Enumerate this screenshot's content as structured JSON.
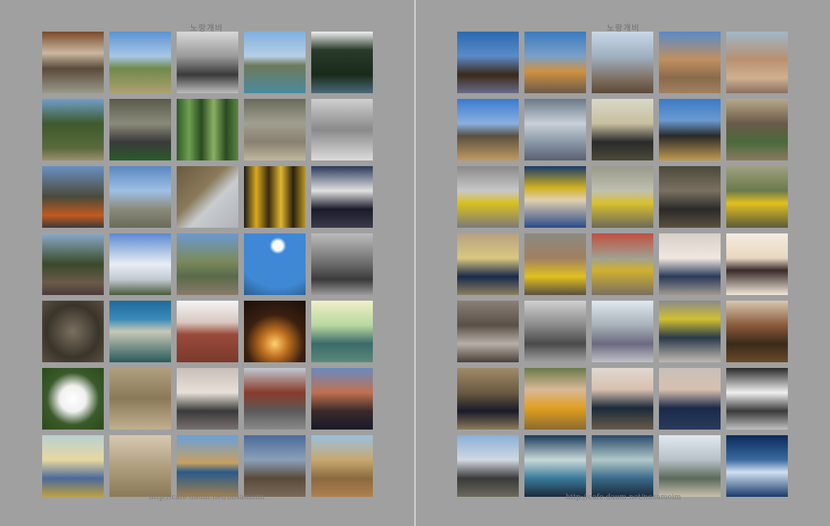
{
  "left_page": {
    "header": "노랑개비",
    "footer": "http://cafe.daum.net/nosamoim",
    "photos": [
      {
        "scene": "group-outdoor",
        "bg": "linear-gradient(#7a4a2a 0%,#c9b8a0 35%,#5a4a3a 60%,#9a9a8a 100%)"
      },
      {
        "scene": "hills-sky",
        "bg": "linear-gradient(#5b93d2 0%,#a9c6e4 40%,#6f8a4a 60%,#b0a070 100%)"
      },
      {
        "scene": "bw-people",
        "bg": "linear-gradient(#d8d8d8 0%,#9a9a9a 40%,#3a3a3a 70%,#bdbdbd 100%)"
      },
      {
        "scene": "pond-village",
        "bg": "linear-gradient(#7fb0e0 0%,#b7cfe5 40%,#6d7a5a 55%,#4a8aa0 100%)"
      },
      {
        "scene": "pine-tree",
        "bg": "linear-gradient(#f0f0f0 0%,#2a3a2a 30%,#1a2a1a 70%,#4a6a7a 100%)"
      },
      {
        "scene": "forest-statue",
        "bg": "linear-gradient(#6f9ec8 0%,#3e5a2e 40%,#5a6a3a 80%,#9a9070 100%)"
      },
      {
        "scene": "people-road",
        "bg": "linear-gradient(#5a5a4a 0%,#8a8a7a 40%,#3a3a3a 70%,#2a5a2a 100%)"
      },
      {
        "scene": "bamboo",
        "bg": "linear-gradient(90deg,#2e5a2a 0%,#6fa050 20%,#2a4a22 40%,#8ab060 60%,#2a4a22 80%,#5a8a40 100%)"
      },
      {
        "scene": "aerial-fields",
        "bg": "linear-gradient(#6a6a5a 0%,#a0a090 40%,#8a8070 70%,#c0b8a0 100%)"
      },
      {
        "scene": "aerial-bw",
        "bg": "linear-gradient(#cfcfcf 0%,#8a8a8a 50%,#dcdcdc 100%)"
      },
      {
        "scene": "woman-trees",
        "bg": "linear-gradient(#6a90c0 0%,#4a4a3a 50%,#c05a20 80%,#3a3a3a 100%)"
      },
      {
        "scene": "mountain-vista",
        "bg": "linear-gradient(#5a86c0 0%,#9ec0e4 40%,#8a8a7a 70%,#6a6a5a 100%)"
      },
      {
        "scene": "rock-sky",
        "bg": "linear-gradient(135deg,#6a5a40 0%,#8a7a5a 40%,#c8ccd0 60%,#b0b4b8 100%)"
      },
      {
        "scene": "yellow-curtain",
        "bg": "linear-gradient(90deg,#1a1a1a 0%,#d8a820 20%,#3a2a10 40%,#e0b830 60%,#2a2010 80%,#c09a20 100%)"
      },
      {
        "scene": "dark-trees",
        "bg": "linear-gradient(#2a3a5a 0%,#e0e0e0 40%,#1a1a2a 70%,#3a3a4a 100%)"
      },
      {
        "scene": "people-bushes",
        "bg": "linear-gradient(#8aaac8 0%,#3a4a2a 50%,#6a5a4a 80%,#4a3a3a 100%)"
      },
      {
        "scene": "white-blossom",
        "bg": "linear-gradient(#5a8ad0 0%,#e8eef4 50%,#c0c8d0 75%,#4a5a3a 100%)"
      },
      {
        "scene": "rocky-peak",
        "bg": "linear-gradient(#6a9ad0 0%,#7a8a5a 45%,#5a6a4a 70%,#8a7a6a 100%)"
      },
      {
        "scene": "cloud-blue",
        "bg": "radial-gradient(circle at 55% 20%,#ffffff 0%,#ffffff 8%,#3d88d8 14%,#3f88d4 70%,#2a5a8a 100%)"
      },
      {
        "scene": "group-bw",
        "bg": "linear-gradient(#bcbcbc 0%,#6a6a6a 50%,#3a3a3a 75%,#9a9a9a 100%)"
      },
      {
        "scene": "pebbles",
        "bg": "radial-gradient(circle,#7a7060 0%,#3a342a 60%,#5a5040 100%)"
      },
      {
        "scene": "pavilion",
        "bg": "linear-gradient(#1f6a9a 0%,#3a8ab8 30%,#c8c8b8 50%,#2a5a5a 100%)"
      },
      {
        "scene": "buddha-carving",
        "bg": "linear-gradient(#f4f4f4 0%,#d8c8c0 35%,#9a4a3a 55%,#7a3a2a 100%)"
      },
      {
        "scene": "candles",
        "bg": "radial-gradient(circle at 50% 70%,#ffd070 0%,#c07020 25%,#3a2010 55%,#1a0e08 100%)"
      },
      {
        "scene": "teal-landscape",
        "bg": "linear-gradient(#f0f0c8 0%,#b8d8a0 40%,#3a6a6a 70%,#5a8a7a 100%)"
      },
      {
        "scene": "chrysanthemum",
        "bg": "radial-gradient(circle,#ffffff 0%,#f0f0f0 30%,#3a5a2a 60%,#2a4a1a 100%)"
      },
      {
        "scene": "dry-grass",
        "bg": "linear-gradient(#b0a080 0%,#8a7a5a 50%,#c0b090 100%)"
      },
      {
        "scene": "meeting-room",
        "bg": "linear-gradient(#c8c0b8 0%,#e8e0d8 40%,#3a3a3a 70%,#7a7070 100%)"
      },
      {
        "scene": "truck-people",
        "bg": "linear-gradient(#c0c8d0 0%,#8a3a2a 40%,#5a5a5a 70%,#8a8a8a 100%)"
      },
      {
        "scene": "three-people",
        "bg": "linear-gradient(#6a8ac0 0%,#c07050 40%,#3a2a2a 70%,#1a1a2a 100%)"
      },
      {
        "scene": "tinted-walk",
        "bg": "linear-gradient(#b8d0d0 0%,#e8d8a0 40%,#4a6a9a 70%,#c0a040 100%)"
      },
      {
        "scene": "hill-path",
        "bg": "linear-gradient(#d8c8b0 0%,#b0a080 50%,#8a7a5a 100%)"
      },
      {
        "scene": "river-reeds",
        "bg": "linear-gradient(#6aa0d8 0%,#c8a060 45%,#2a5a8a 60%,#a08050 100%)"
      },
      {
        "scene": "reeds-water",
        "bg": "linear-gradient(#4a6a9a 0%,#8aa0b8 40%,#5a4a3a 70%,#7a6a5a 100%)"
      },
      {
        "scene": "boardwalk",
        "bg": "linear-gradient(#9ac0e0 0%,#c8a870 40%,#8a6a40 70%,#b08050 100%)"
      }
    ]
  },
  "right_page": {
    "header": "노랑개비",
    "footer": "http://cafe.daum.net/nosamoim",
    "photos": [
      {
        "scene": "couple-lake",
        "bg": "linear-gradient(#2a6ab0 0%,#5a8ac8 40%,#3a2a1a 70%,#6a6a8a 100%)"
      },
      {
        "scene": "group-railing",
        "bg": "linear-gradient(#3a7ac0 0%,#7aa0c8 40%,#d09040 65%,#6a5a4a 100%)"
      },
      {
        "scene": "bare-tree",
        "bg": "linear-gradient(#c8d8e8 0%,#a0b0c0 40%,#7a6a5a 80%,#5a4a3a 100%)"
      },
      {
        "scene": "field-walkers",
        "bg": "linear-gradient(#5a8ac8 0%,#c09060 45%,#8a6a4a 75%,#a08060 100%)"
      },
      {
        "scene": "group-trail",
        "bg": "linear-gradient(#a0b8c8 0%,#b89070 45%,#d0b090 75%,#8a7060 100%)"
      },
      {
        "scene": "mountain-grass",
        "bg": "linear-gradient(#3a7ad0 0%,#8ab0e0 40%,#5a5040 60%,#c09a60 100%)"
      },
      {
        "scene": "frozen-ice",
        "bg": "linear-gradient(#6a7a8a 0%,#c8d0d8 40%,#8a98a8 70%,#5a6070 100%)"
      },
      {
        "scene": "man-stick",
        "bg": "linear-gradient(#d8d8c8 0%,#c8c0a0 40%,#2a2a2a 70%,#4a4a3a 100%)"
      },
      {
        "scene": "group-sky",
        "bg": "linear-gradient(#3a7ac8 0%,#6a9ad0 35%,#2a2a2a 60%,#c09a50 100%)"
      },
      {
        "scene": "planting-slope",
        "bg": "linear-gradient(#b8a888 0%,#6a5a4a 40%,#4a6a3a 70%,#8a7a60 100%)"
      },
      {
        "scene": "yellow-vest-work",
        "bg": "linear-gradient(#8a8a8a 0%,#c8c8c8 40%,#d8c020 60%,#7a7a7a 100%)"
      },
      {
        "scene": "laughing-group",
        "bg": "linear-gradient(#1a3a6a 0%,#d0b020 35%,#e0d0b0 55%,#2a4a8a 100%)"
      },
      {
        "scene": "rock-worker",
        "bg": "linear-gradient(#9a9a8a 0%,#c0c0b0 40%,#d8c030 60%,#6a6a5a 100%)"
      },
      {
        "scene": "tree-digging",
        "bg": "linear-gradient(#4a4a3a 0%,#7a7060 40%,#2a2a2a 70%,#5a5040 100%)"
      },
      {
        "scene": "yellow-vests-hill",
        "bg": "linear-gradient(#a0a080 0%,#6a7a4a 40%,#e0c020 60%,#5a5a3a 100%)"
      },
      {
        "scene": "hammer-worker",
        "bg": "linear-gradient(#b8a080 0%,#d8c880 40%,#1a2a4a 70%,#8a8060 100%)"
      },
      {
        "scene": "brush-carrier",
        "bg": "linear-gradient(#8a8a80 0%,#a08060 40%,#e0c020 70%,#5a5040 100%)"
      },
      {
        "scene": "shed-workers",
        "bg": "linear-gradient(#c05040 0%,#a0a090 40%,#d0b030 60%,#7a7060 100%)"
      },
      {
        "scene": "hall-group",
        "bg": "linear-gradient(#d8d0c8 0%,#f0e8e0 40%,#2a3a5a 70%,#a09890 100%)"
      },
      {
        "scene": "man-phone",
        "bg": "linear-gradient(#f4ece0 0%,#e8d8c0 40%,#3a2a2a 60%,#f0e8d8 100%)"
      },
      {
        "scene": "meeting-table",
        "bg": "linear-gradient(#8a8078 0%,#5a5048 40%,#b8b0a8 70%,#4a4038 100%)"
      },
      {
        "scene": "bw-bench",
        "bg": "linear-gradient(#d0d0d0 0%,#8a8a8a 40%,#4a4a4a 70%,#a0a0a0 100%)"
      },
      {
        "scene": "group-banner",
        "bg": "linear-gradient(#e0e8f0 0%,#a8b0b8 40%,#6a6a80 70%,#c0c0c8 100%)"
      },
      {
        "scene": "two-men-sign",
        "bg": "linear-gradient(#8a8a8a 0%,#d0c030 30%,#2a3a4a 60%,#c0b8b0 100%)"
      },
      {
        "scene": "man-portrait",
        "bg": "linear-gradient(#d8c8b0 0%,#8a5a3a 40%,#3a2a1a 70%,#6a4a2a 100%)"
      },
      {
        "scene": "branch-cutter",
        "bg": "linear-gradient(#a08a6a 0%,#6a5a40 40%,#1a1a2a 70%,#8a7a5a 100%)"
      },
      {
        "scene": "woman-yellow",
        "bg": "linear-gradient(#6a7a4a 0%,#d8b898 35%,#e0a020 65%,#8a6a30 100%)"
      },
      {
        "scene": "woman-glasses",
        "bg": "linear-gradient(#e0d8d0 0%,#d8c0b0 35%,#1a2a3a 65%,#6a5a4a 100%)"
      },
      {
        "scene": "man-natgeo",
        "bg": "linear-gradient(#c8c0b8 0%,#d8c0b0 35%,#1a2a4a 65%,#2a3a5a 100%)"
      },
      {
        "scene": "bw-woman",
        "bg": "linear-gradient(#2a2a2a 0%,#f0f0f0 40%,#3a3a3a 70%,#c0c0c0 100%)"
      },
      {
        "scene": "tree-workers",
        "bg": "linear-gradient(#8ab0d8 0%,#d0d8e0 40%,#3a3a3a 70%,#6a6a5a 100%)"
      },
      {
        "scene": "teal-man",
        "bg": "linear-gradient(#1a3a5a 0%,#c8d8d8 40%,#3a7a9a 70%,#1a2a3a 100%)"
      },
      {
        "scene": "teal-man-2",
        "bg": "linear-gradient(#2a4a6a 0%,#b0c8c8 40%,#3a6a8a 70%,#1a2a3a 100%)"
      },
      {
        "scene": "street-walkers",
        "bg": "linear-gradient(#e0e8f0 0%,#b8c0c8 40%,#5a6a5a 70%,#c8c0b0 100%)"
      },
      {
        "scene": "bus-interior",
        "bg": "linear-gradient(#0a2a5a 0%,#3a6aa0 40%,#d0e0f0 60%,#1a3a6a 100%)"
      }
    ]
  }
}
